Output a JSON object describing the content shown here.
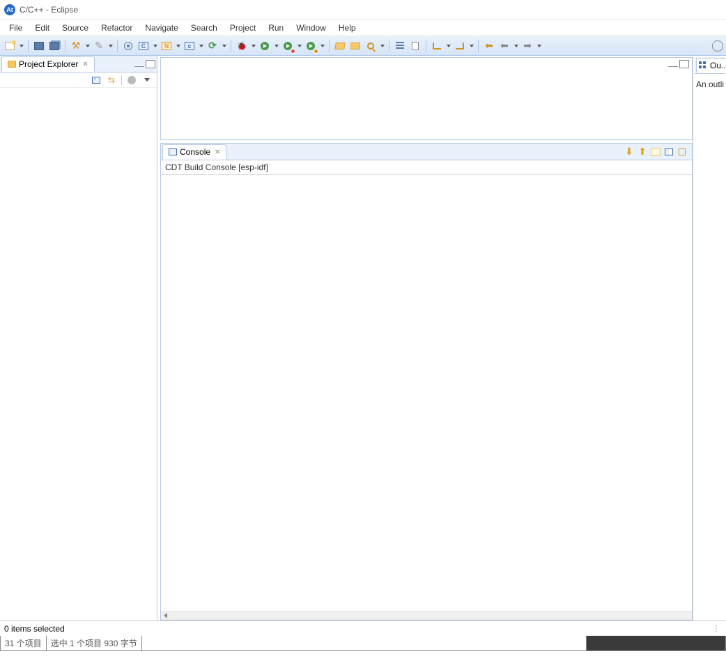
{
  "window": {
    "title": "C/C++ - Eclipse",
    "logo_text": "At"
  },
  "menu": [
    "File",
    "Edit",
    "Source",
    "Refactor",
    "Navigate",
    "Search",
    "Project",
    "Run",
    "Window",
    "Help"
  ],
  "project_explorer": {
    "title": "Project Explorer",
    "close_glyph": "✕"
  },
  "outline": {
    "tab_label": "Ou...",
    "body_text": "An outli"
  },
  "console": {
    "tab_label": "Console",
    "close_glyph": "✕",
    "header": "CDT Build Console [esp-idf]"
  },
  "status": {
    "left": "0 items selected",
    "right": "⋮"
  },
  "bottom": {
    "seg1": "31 个项目",
    "seg2": "选中 1 个项目 930 字节"
  }
}
